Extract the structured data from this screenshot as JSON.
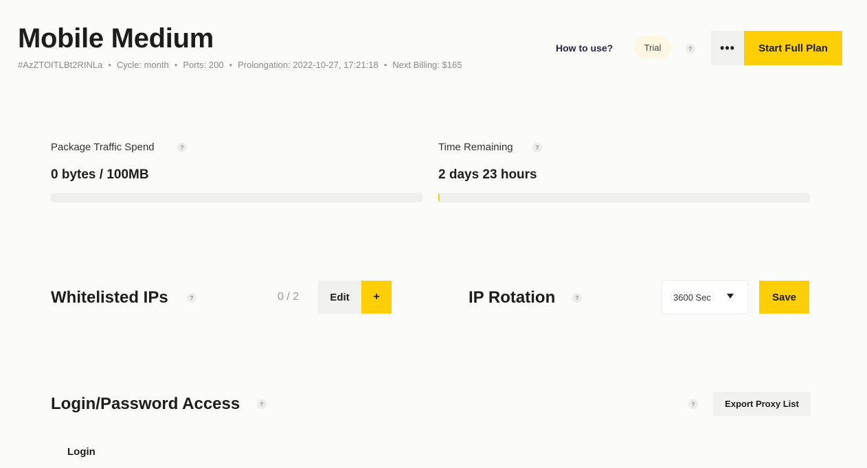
{
  "header": {
    "title": "Mobile Medium",
    "meta": {
      "id": "#AzZTOITLBt2RINLa",
      "cycle": "Cycle: month",
      "ports": "Ports: 200",
      "prolongation": "Prolongation: 2022-10-27, 17:21:18",
      "billing": "Next Billing: $165"
    },
    "how_to_use": "How to use?",
    "trial_badge": "Trial",
    "help_glyph": "?",
    "more_glyph": "•••",
    "start_button": "Start Full Plan"
  },
  "stats": {
    "traffic": {
      "label": "Package Traffic Spend",
      "value": "0 bytes / 100MB",
      "progress": 0.0
    },
    "time": {
      "label": "Time Remaining",
      "value": "2 days 23 hours",
      "progress": 0.003
    }
  },
  "whitelist": {
    "title": "Whitelisted IPs",
    "count": "0 / 2",
    "edit_label": "Edit",
    "add_label": "+"
  },
  "rotation": {
    "title": "IP Rotation",
    "selected": "3600 Sec",
    "save_label": "Save"
  },
  "access": {
    "title": "Login/Password Access",
    "export_label": "Export Proxy List",
    "table_header_login": "Login"
  },
  "colors": {
    "accent": "#ffcf05",
    "background": "#fbfbf9"
  }
}
